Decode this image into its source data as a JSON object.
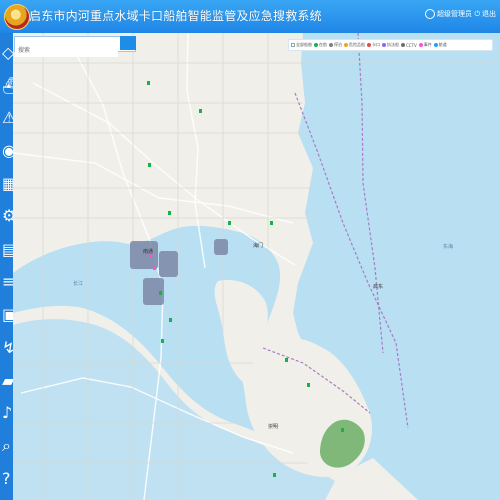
{
  "header": {
    "title": "启东市内河重点水域卡口船舶智能监管及应急搜救系统",
    "user_label": "超级管理员",
    "logout_label": "退出"
  },
  "search": {
    "placeholder": "搜索"
  },
  "legend": [
    {
      "label": "全部船舶",
      "color": "#2aa6ff",
      "kind": "check"
    },
    {
      "label": "在航",
      "color": "#16b34a",
      "kind": "dot"
    },
    {
      "label": "停泊",
      "color": "#7a7f88",
      "kind": "dot"
    },
    {
      "label": "危险品船",
      "color": "#f0a322",
      "kind": "dot"
    },
    {
      "label": "卡口",
      "color": "#e54b4b",
      "kind": "dot"
    },
    {
      "label": "执法船",
      "color": "#8d64ff",
      "kind": "dot"
    },
    {
      "label": "CCTV",
      "color": "#6d6e71",
      "kind": "dot"
    },
    {
      "label": "事件",
      "color": "#ff4fd8",
      "kind": "dot"
    },
    {
      "label": "航道",
      "color": "#20a0ff",
      "kind": "dot"
    }
  ],
  "map_labels": [
    {
      "text": "南通",
      "class": "city"
    },
    {
      "text": "海门",
      "class": "city"
    },
    {
      "text": "启东",
      "class": "city"
    },
    {
      "text": "崇明",
      "class": "city"
    },
    {
      "text": "长江",
      "class": "water"
    },
    {
      "text": "东海",
      "class": "water"
    }
  ],
  "sidebar": {
    "icons": [
      "map-icon",
      "ship-icon",
      "alert-icon",
      "camera-icon",
      "chart-icon",
      "settings-icon",
      "document-icon",
      "layers-icon",
      "calendar-icon",
      "route-icon",
      "folder-icon",
      "bell-icon",
      "search-icon",
      "user-icon",
      "help-icon"
    ]
  },
  "colors": {
    "header": "#2b90ee",
    "sidebar": "#1f7fda",
    "water": "#b9dff3",
    "land": "#f1efe9",
    "road_major": "#ffffff",
    "road_minor": "#d9d7d2",
    "boundary": "#a97cc7",
    "marker_green": "#16b34a",
    "marker_pink": "#ff4fd8",
    "marker_red": "#e54b4b"
  }
}
